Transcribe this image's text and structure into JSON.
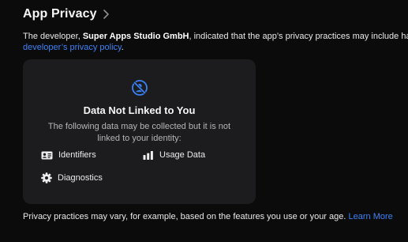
{
  "section": {
    "title": "App Privacy"
  },
  "description": {
    "prefix": "The developer, ",
    "developer_name": "Super Apps Studio GmbH",
    "middle": ", indicated that the app’s privacy practices may include handling",
    "policy_link": "developer’s privacy policy",
    "suffix": "."
  },
  "card": {
    "title": "Data Not Linked to You",
    "subtitle_line1": "The following data may be collected but it is not",
    "subtitle_line2": "linked to your identity:",
    "items": [
      {
        "label": "Identifiers",
        "icon": "id-card-icon"
      },
      {
        "label": "Usage Data",
        "icon": "bar-chart-icon"
      },
      {
        "label": "Diagnostics",
        "icon": "gear-icon"
      }
    ],
    "accent": "#3b82f6"
  },
  "footer": {
    "text": "Privacy practices may vary, for example, based on the features you use or your age.",
    "learn_more": "Learn More"
  }
}
